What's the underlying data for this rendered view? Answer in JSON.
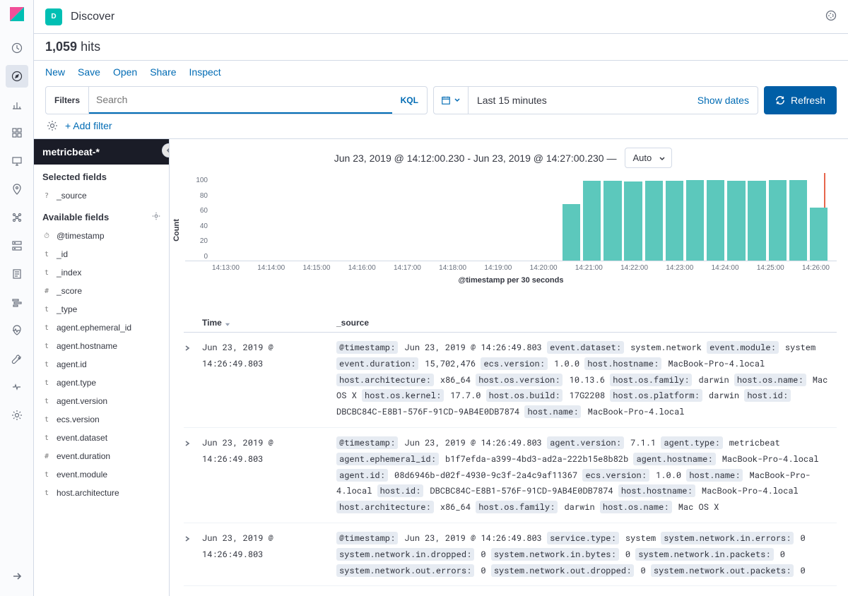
{
  "header": {
    "app_letter": "D",
    "app_name": "Discover"
  },
  "hits": {
    "count": "1,059",
    "label": "hits"
  },
  "menu": [
    "New",
    "Save",
    "Open",
    "Share",
    "Inspect"
  ],
  "filters": {
    "label": "Filters",
    "search_placeholder": "Search",
    "kql": "KQL"
  },
  "datepicker": {
    "range": "Last 15 minutes",
    "show_dates": "Show dates"
  },
  "refresh": "Refresh",
  "add_filter": "+ Add filter",
  "sidebar": {
    "index_pattern": "metricbeat-*",
    "selected_title": "Selected fields",
    "selected": [
      {
        "type": "?",
        "name": "_source"
      }
    ],
    "available_title": "Available fields",
    "available": [
      {
        "type": "⏱",
        "name": "@timestamp"
      },
      {
        "type": "t",
        "name": "_id"
      },
      {
        "type": "t",
        "name": "_index"
      },
      {
        "type": "#",
        "name": "_score"
      },
      {
        "type": "t",
        "name": "_type"
      },
      {
        "type": "t",
        "name": "agent.ephemeral_id"
      },
      {
        "type": "t",
        "name": "agent.hostname"
      },
      {
        "type": "t",
        "name": "agent.id"
      },
      {
        "type": "t",
        "name": "agent.type"
      },
      {
        "type": "t",
        "name": "agent.version"
      },
      {
        "type": "t",
        "name": "ecs.version"
      },
      {
        "type": "t",
        "name": "event.dataset"
      },
      {
        "type": "#",
        "name": "event.duration"
      },
      {
        "type": "t",
        "name": "event.module"
      },
      {
        "type": "t",
        "name": "host.architecture"
      }
    ]
  },
  "chart_data": {
    "type": "bar",
    "title": "Jun 23, 2019 @ 14:12:00.230 - Jun 23, 2019 @ 14:27:00.230 —",
    "interval": "Auto",
    "ylabel": "Count",
    "xlabel": "@timestamp per 30 seconds",
    "ylim": [
      0,
      100
    ],
    "yticks": [
      100,
      80,
      60,
      40,
      20,
      0
    ],
    "xticks": [
      "14:13:00",
      "14:14:00",
      "14:15:00",
      "14:16:00",
      "14:17:00",
      "14:18:00",
      "14:19:00",
      "14:20:00",
      "14:21:00",
      "14:22:00",
      "14:23:00",
      "14:24:00",
      "14:25:00",
      "14:26:00"
    ],
    "values": [
      0,
      0,
      0,
      0,
      0,
      0,
      0,
      0,
      0,
      0,
      0,
      0,
      0,
      0,
      0,
      0,
      0,
      67,
      95,
      95,
      94,
      95,
      95,
      96,
      96,
      95,
      95,
      96,
      96,
      63
    ]
  },
  "columns": {
    "time": "Time",
    "source": "_source"
  },
  "rows": [
    {
      "time": "Jun 23, 2019 @ 14:26:49.803",
      "source": [
        [
          "@timestamp:",
          "Jun 23, 2019 @ 14:26:49.803"
        ],
        [
          "event.dataset:",
          "system.network"
        ],
        [
          "event.module:",
          "system"
        ],
        [
          "event.duration:",
          "15,702,476"
        ],
        [
          "ecs.version:",
          "1.0.0"
        ],
        [
          "host.hostname:",
          "MacBook-Pro-4.local"
        ],
        [
          "host.architecture:",
          "x86_64"
        ],
        [
          "host.os.version:",
          "10.13.6"
        ],
        [
          "host.os.family:",
          "darwin"
        ],
        [
          "host.os.name:",
          "Mac OS X"
        ],
        [
          "host.os.kernel:",
          "17.7.0"
        ],
        [
          "host.os.build:",
          "17G2208"
        ],
        [
          "host.os.platform:",
          "darwin"
        ],
        [
          "host.id:",
          "DBCBC84C-E8B1-576F-91CD-9AB4E0DB7874"
        ],
        [
          "host.name:",
          "MacBook-Pro-4.local"
        ]
      ]
    },
    {
      "time": "Jun 23, 2019 @ 14:26:49.803",
      "source": [
        [
          "@timestamp:",
          "Jun 23, 2019 @ 14:26:49.803"
        ],
        [
          "agent.version:",
          "7.1.1"
        ],
        [
          "agent.type:",
          "metricbeat"
        ],
        [
          "agent.ephemeral_id:",
          "b1f7efda-a399-4bd3-ad2a-222b15e8b82b"
        ],
        [
          "agent.hostname:",
          "MacBook-Pro-4.local"
        ],
        [
          "agent.id:",
          "08d6946b-d02f-4930-9c3f-2a4c9af11367"
        ],
        [
          "ecs.version:",
          "1.0.0"
        ],
        [
          "host.name:",
          "MacBook-Pro-4.local"
        ],
        [
          "host.id:",
          "DBCBC84C-E8B1-576F-91CD-9AB4E0DB7874"
        ],
        [
          "host.hostname:",
          "MacBook-Pro-4.local"
        ],
        [
          "host.architecture:",
          "x86_64"
        ],
        [
          "host.os.family:",
          "darwin"
        ],
        [
          "host.os.name:",
          "Mac OS X"
        ]
      ]
    },
    {
      "time": "Jun 23, 2019 @ 14:26:49.803",
      "source": [
        [
          "@timestamp:",
          "Jun 23, 2019 @ 14:26:49.803"
        ],
        [
          "service.type:",
          "system"
        ],
        [
          "system.network.in.errors:",
          "0"
        ],
        [
          "system.network.in.dropped:",
          "0"
        ],
        [
          "system.network.in.bytes:",
          "0"
        ],
        [
          "system.network.in.packets:",
          "0"
        ],
        [
          "system.network.out.errors:",
          "0"
        ],
        [
          "system.network.out.dropped:",
          "0"
        ],
        [
          "system.network.out.packets:",
          "0"
        ]
      ]
    }
  ]
}
